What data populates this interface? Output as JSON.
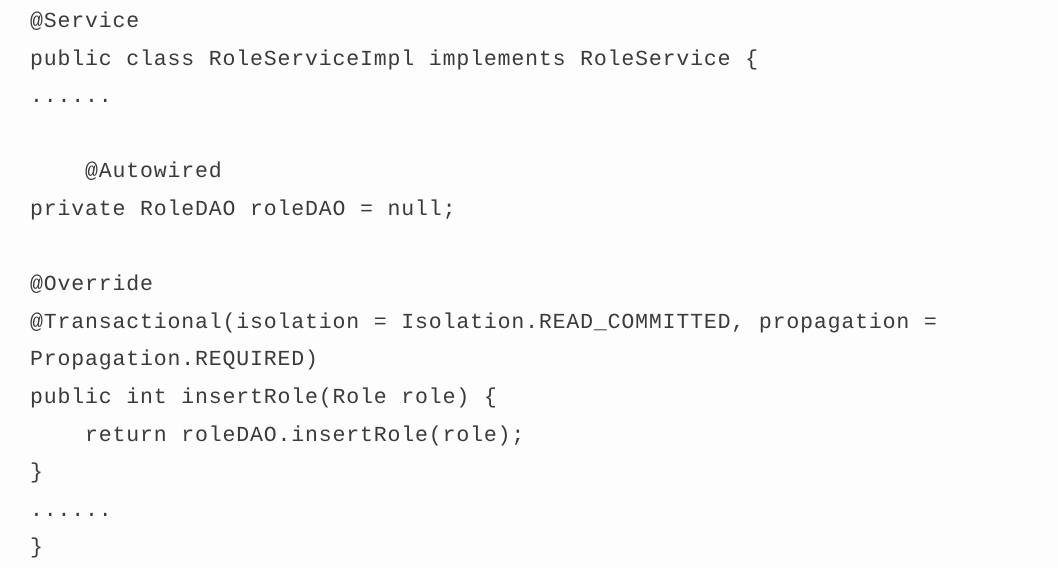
{
  "document": {
    "kind": "code-listing",
    "language": "java",
    "background_color": "#fdfdfd",
    "text_color": "#3b3b3b",
    "lines": [
      "@Service",
      "public class RoleServiceImpl implements RoleService {",
      "......",
      "",
      "    @Autowired",
      "private RoleDAO roleDAO = null;",
      "",
      "@Override",
      "@Transactional(isolation = Isolation.READ_COMMITTED, propagation =",
      "Propagation.REQUIRED)",
      "public int insertRole(Role role) {",
      "    return roleDAO.insertRole(role);",
      "}",
      "......",
      "}"
    ]
  }
}
